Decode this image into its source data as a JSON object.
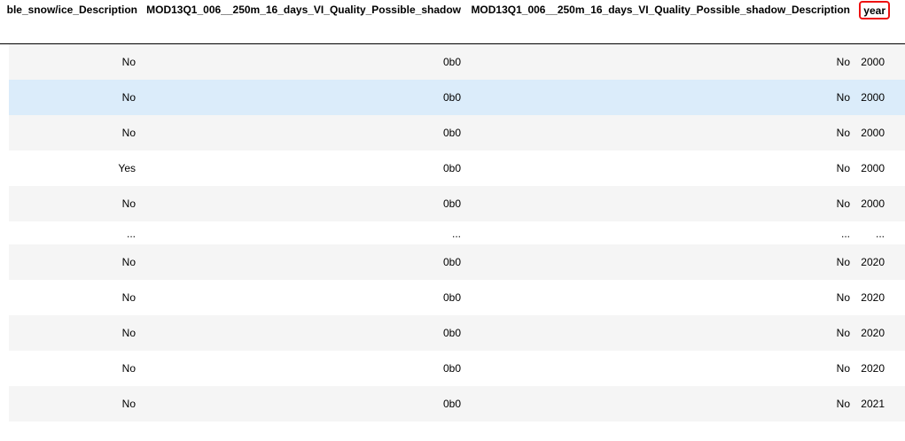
{
  "table": {
    "columns": [
      "ble_snow/ice_Description",
      "MOD13Q1_006__250m_16_days_VI_Quality_Possible_shadow",
      "MOD13Q1_006__250m_16_days_VI_Quality_Possible_shadow_Description",
      "year"
    ],
    "highlighted_column": "year",
    "highlight_color": "#ee1111",
    "hover_row_color": "#dbecfa",
    "stripe_color": "#f5f5f5",
    "rows": [
      [
        "No",
        "0b0",
        "No",
        "2000"
      ],
      [
        "No",
        "0b0",
        "No",
        "2000"
      ],
      [
        "No",
        "0b0",
        "No",
        "2000"
      ],
      [
        "Yes",
        "0b0",
        "No",
        "2000"
      ],
      [
        "No",
        "0b0",
        "No",
        "2000"
      ],
      [
        "...",
        "...",
        "...",
        "..."
      ],
      [
        "No",
        "0b0",
        "No",
        "2020"
      ],
      [
        "No",
        "0b0",
        "No",
        "2020"
      ],
      [
        "No",
        "0b0",
        "No",
        "2020"
      ],
      [
        "No",
        "0b0",
        "No",
        "2020"
      ],
      [
        "No",
        "0b0",
        "No",
        "2021"
      ]
    ]
  }
}
